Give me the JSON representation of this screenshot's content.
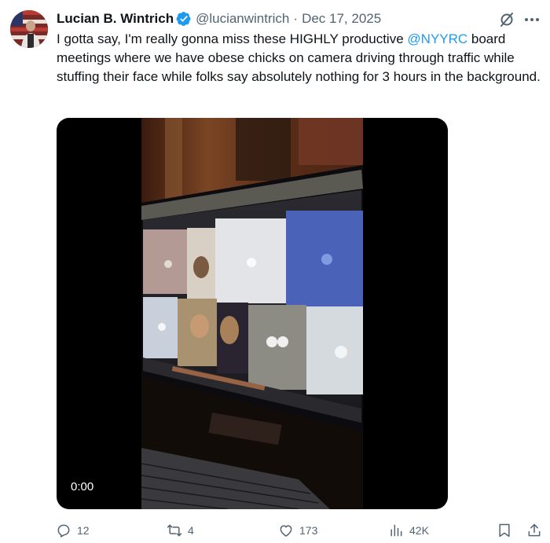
{
  "author": {
    "name": "Lucian B. Wintrich",
    "handle": "@lucianwintrich",
    "separator": "·",
    "date": "Dec 17, 2025"
  },
  "tweet": {
    "text_before": "I gotta say, I'm really gonna miss these HIGHLY productive ",
    "mention": "@NYYRC",
    "text_after": "  board meetings where we have obese chicks on camera driving through traffic while stuffing their face while folks say absolutely nothing for 3 hours in the background."
  },
  "media": {
    "timestamp": "0:00"
  },
  "actions": {
    "replies": "12",
    "reposts": "4",
    "likes": "173",
    "views": "42K"
  },
  "colors": {
    "accent": "#1d9bf0",
    "muted": "#536471",
    "text": "#0f1419"
  },
  "icons": [
    "verified-badge-icon",
    "grok-icon",
    "more-icon",
    "reply-icon",
    "retweet-icon",
    "like-icon",
    "views-icon",
    "bookmark-icon",
    "share-icon"
  ]
}
